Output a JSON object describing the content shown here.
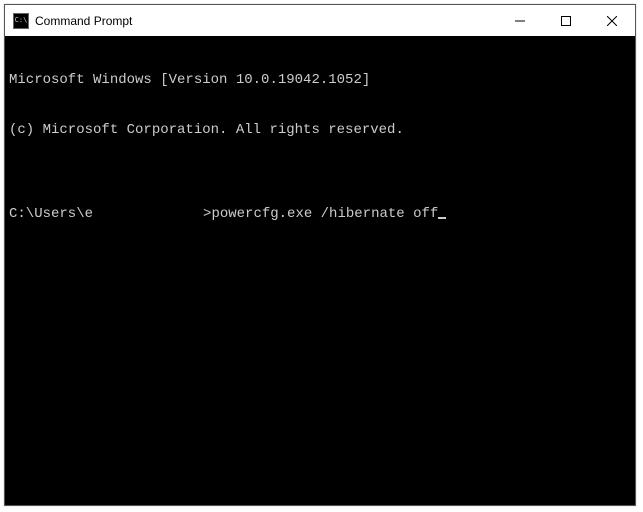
{
  "window": {
    "title": "Command Prompt",
    "icon_glyph": "C:\\"
  },
  "terminal": {
    "line1": "Microsoft Windows [Version 10.0.19042.1052]",
    "line2": "(c) Microsoft Corporation. All rights reserved.",
    "blank": "",
    "prompt_prefix": "C:\\Users\\",
    "prompt_user_partial": "e",
    "prompt_suffix": ">",
    "command": "powercfg.exe /hibernate off"
  }
}
